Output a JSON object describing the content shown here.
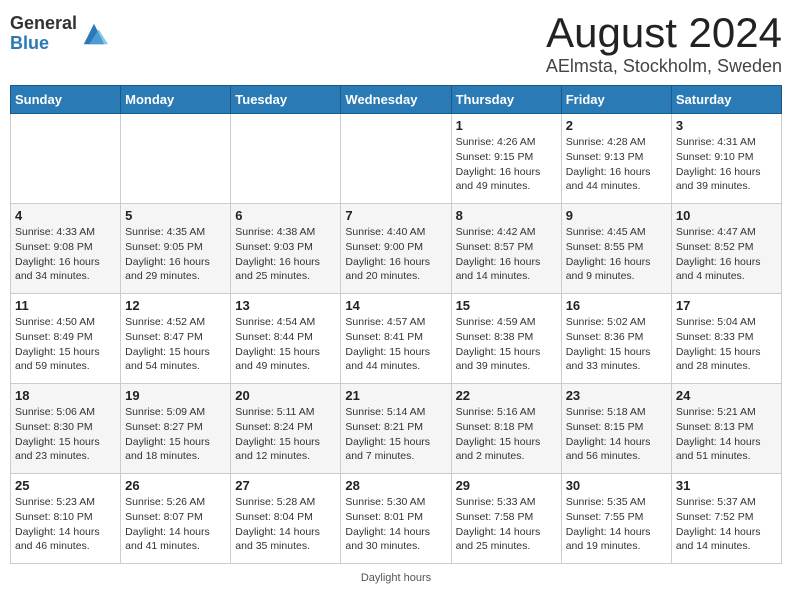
{
  "header": {
    "logo_general": "General",
    "logo_blue": "Blue",
    "month": "August 2024",
    "location": "AElmsta, Stockholm, Sweden"
  },
  "days_of_week": [
    "Sunday",
    "Monday",
    "Tuesday",
    "Wednesday",
    "Thursday",
    "Friday",
    "Saturday"
  ],
  "weeks": [
    [
      {
        "day": "",
        "info": ""
      },
      {
        "day": "",
        "info": ""
      },
      {
        "day": "",
        "info": ""
      },
      {
        "day": "",
        "info": ""
      },
      {
        "day": "1",
        "info": "Sunrise: 4:26 AM\nSunset: 9:15 PM\nDaylight: 16 hours and 49 minutes."
      },
      {
        "day": "2",
        "info": "Sunrise: 4:28 AM\nSunset: 9:13 PM\nDaylight: 16 hours and 44 minutes."
      },
      {
        "day": "3",
        "info": "Sunrise: 4:31 AM\nSunset: 9:10 PM\nDaylight: 16 hours and 39 minutes."
      }
    ],
    [
      {
        "day": "4",
        "info": "Sunrise: 4:33 AM\nSunset: 9:08 PM\nDaylight: 16 hours and 34 minutes."
      },
      {
        "day": "5",
        "info": "Sunrise: 4:35 AM\nSunset: 9:05 PM\nDaylight: 16 hours and 29 minutes."
      },
      {
        "day": "6",
        "info": "Sunrise: 4:38 AM\nSunset: 9:03 PM\nDaylight: 16 hours and 25 minutes."
      },
      {
        "day": "7",
        "info": "Sunrise: 4:40 AM\nSunset: 9:00 PM\nDaylight: 16 hours and 20 minutes."
      },
      {
        "day": "8",
        "info": "Sunrise: 4:42 AM\nSunset: 8:57 PM\nDaylight: 16 hours and 14 minutes."
      },
      {
        "day": "9",
        "info": "Sunrise: 4:45 AM\nSunset: 8:55 PM\nDaylight: 16 hours and 9 minutes."
      },
      {
        "day": "10",
        "info": "Sunrise: 4:47 AM\nSunset: 8:52 PM\nDaylight: 16 hours and 4 minutes."
      }
    ],
    [
      {
        "day": "11",
        "info": "Sunrise: 4:50 AM\nSunset: 8:49 PM\nDaylight: 15 hours and 59 minutes."
      },
      {
        "day": "12",
        "info": "Sunrise: 4:52 AM\nSunset: 8:47 PM\nDaylight: 15 hours and 54 minutes."
      },
      {
        "day": "13",
        "info": "Sunrise: 4:54 AM\nSunset: 8:44 PM\nDaylight: 15 hours and 49 minutes."
      },
      {
        "day": "14",
        "info": "Sunrise: 4:57 AM\nSunset: 8:41 PM\nDaylight: 15 hours and 44 minutes."
      },
      {
        "day": "15",
        "info": "Sunrise: 4:59 AM\nSunset: 8:38 PM\nDaylight: 15 hours and 39 minutes."
      },
      {
        "day": "16",
        "info": "Sunrise: 5:02 AM\nSunset: 8:36 PM\nDaylight: 15 hours and 33 minutes."
      },
      {
        "day": "17",
        "info": "Sunrise: 5:04 AM\nSunset: 8:33 PM\nDaylight: 15 hours and 28 minutes."
      }
    ],
    [
      {
        "day": "18",
        "info": "Sunrise: 5:06 AM\nSunset: 8:30 PM\nDaylight: 15 hours and 23 minutes."
      },
      {
        "day": "19",
        "info": "Sunrise: 5:09 AM\nSunset: 8:27 PM\nDaylight: 15 hours and 18 minutes."
      },
      {
        "day": "20",
        "info": "Sunrise: 5:11 AM\nSunset: 8:24 PM\nDaylight: 15 hours and 12 minutes."
      },
      {
        "day": "21",
        "info": "Sunrise: 5:14 AM\nSunset: 8:21 PM\nDaylight: 15 hours and 7 minutes."
      },
      {
        "day": "22",
        "info": "Sunrise: 5:16 AM\nSunset: 8:18 PM\nDaylight: 15 hours and 2 minutes."
      },
      {
        "day": "23",
        "info": "Sunrise: 5:18 AM\nSunset: 8:15 PM\nDaylight: 14 hours and 56 minutes."
      },
      {
        "day": "24",
        "info": "Sunrise: 5:21 AM\nSunset: 8:13 PM\nDaylight: 14 hours and 51 minutes."
      }
    ],
    [
      {
        "day": "25",
        "info": "Sunrise: 5:23 AM\nSunset: 8:10 PM\nDaylight: 14 hours and 46 minutes."
      },
      {
        "day": "26",
        "info": "Sunrise: 5:26 AM\nSunset: 8:07 PM\nDaylight: 14 hours and 41 minutes."
      },
      {
        "day": "27",
        "info": "Sunrise: 5:28 AM\nSunset: 8:04 PM\nDaylight: 14 hours and 35 minutes."
      },
      {
        "day": "28",
        "info": "Sunrise: 5:30 AM\nSunset: 8:01 PM\nDaylight: 14 hours and 30 minutes."
      },
      {
        "day": "29",
        "info": "Sunrise: 5:33 AM\nSunset: 7:58 PM\nDaylight: 14 hours and 25 minutes."
      },
      {
        "day": "30",
        "info": "Sunrise: 5:35 AM\nSunset: 7:55 PM\nDaylight: 14 hours and 19 minutes."
      },
      {
        "day": "31",
        "info": "Sunrise: 5:37 AM\nSunset: 7:52 PM\nDaylight: 14 hours and 14 minutes."
      }
    ]
  ],
  "footer": {
    "text": "Daylight hours",
    "url": "https://www.generalblue.com"
  }
}
